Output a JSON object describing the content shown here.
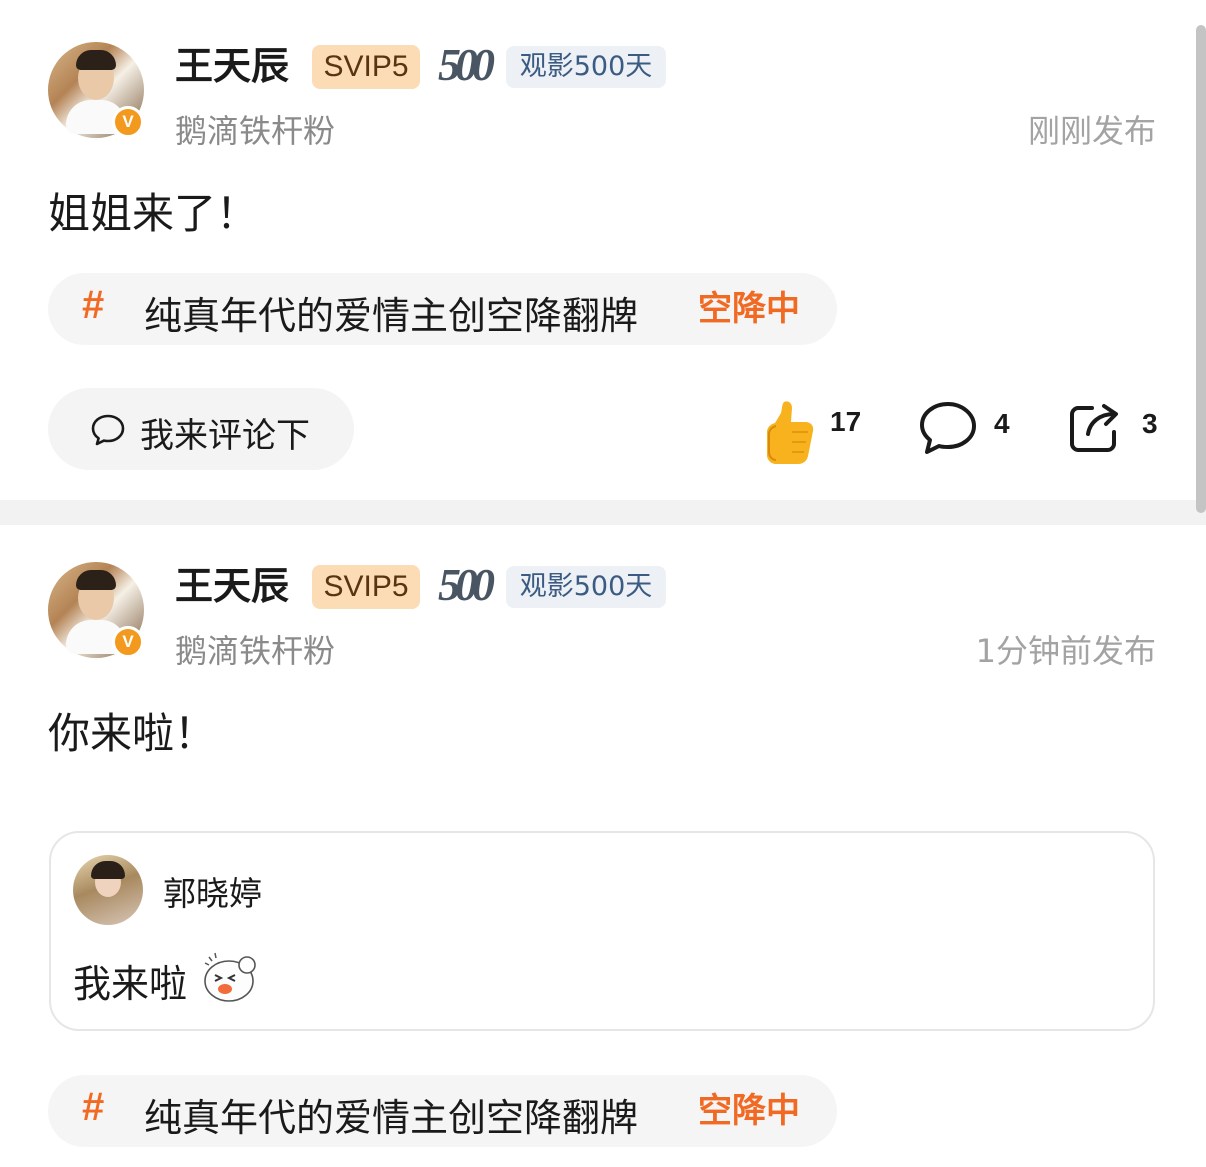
{
  "posts": [
    {
      "username": "王天辰",
      "vip": "SVIP5",
      "badge_big": "500",
      "badge_text": "观影500天",
      "fan_title": "鹅滴铁杆粉",
      "time": "刚刚发布",
      "content": "姐姐来了！",
      "topic": {
        "hash": "#",
        "text": "纯真年代的爱情主创空降翻牌",
        "tag": "空降中"
      },
      "comment_placeholder": "我来评论下",
      "likes": "17",
      "comments": "4",
      "shares": "3"
    },
    {
      "username": "王天辰",
      "vip": "SVIP5",
      "badge_big": "500",
      "badge_text": "观影500天",
      "fan_title": "鹅滴铁杆粉",
      "time": "1分钟前发布",
      "content": "你来啦！",
      "quote": {
        "username": "郭晓婷",
        "text": "我来啦"
      },
      "topic": {
        "hash": "#",
        "text": "纯真年代的爱情主创空降翻牌",
        "tag": "空降中"
      }
    }
  ],
  "colors": {
    "accent": "#f06a24",
    "vip_bg": "#fbdcb5",
    "verified": "#f39a1e"
  }
}
